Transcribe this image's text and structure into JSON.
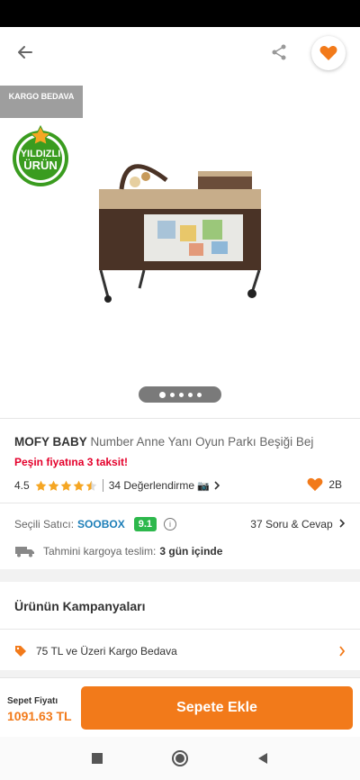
{
  "badges": {
    "cargo": "KARGO BEDAVA",
    "star_line1": "YILDIZLI",
    "star_line2": "ÜRÜN"
  },
  "product": {
    "brand": "MOFY BABY",
    "name": "Number Anne Yanı Oyun Parkı Beşiği Bej",
    "installment": "Peşin fiyatına 3 taksit!",
    "rating": "4.5",
    "rating_value": 4.5,
    "reviews": "34 Değerlendirme",
    "likes": "2B"
  },
  "seller": {
    "label": "Seçili Satıcı:",
    "name": "SOOBOX",
    "score": "9.1",
    "qa": "37 Soru & Cevap"
  },
  "delivery": {
    "label": "Tahmini kargoya teslim:",
    "days": "3 gün içinde"
  },
  "campaigns": {
    "title": "Ürünün Kampanyaları",
    "item": "75 TL ve Üzeri Kargo Bedava"
  },
  "cart": {
    "price_label": "Sepet Fiyatı",
    "price": "1091.63 TL",
    "button": "Sepete Ekle"
  },
  "colors": {
    "accent": "#f27a1a",
    "installment": "#e4002b",
    "seller": "#1c7eb8",
    "score": "#2db84c",
    "star": "#f5a623"
  },
  "icons": [
    "back-arrow-icon",
    "share-icon",
    "heart-icon",
    "camera-icon",
    "chevron-right-icon",
    "truck-icon",
    "tag-icon",
    "info-icon"
  ],
  "pager": {
    "count": 5,
    "active": 0
  }
}
